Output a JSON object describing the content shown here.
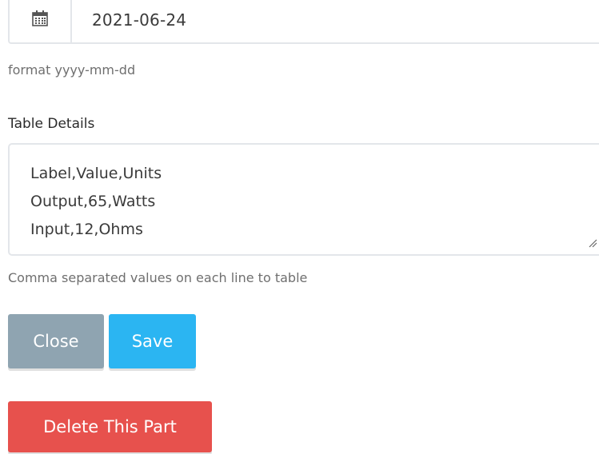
{
  "date_field": {
    "value": "2021-06-24",
    "icon": "calendar-icon",
    "help_text": "format yyyy-mm-dd"
  },
  "table_details": {
    "label": "Table Details",
    "lines": [
      "Label,Value,Units",
      "Output,65,Watts",
      "Input,12,Ohms"
    ],
    "help_text": "Comma separated values on each line to table"
  },
  "actions": {
    "close_label": "Close",
    "save_label": "Save",
    "delete_label": "Delete This Part"
  },
  "colors": {
    "close": "#8fa4b1",
    "save": "#2bb5f2",
    "delete": "#e7514d",
    "border": "#e3e6ea"
  }
}
